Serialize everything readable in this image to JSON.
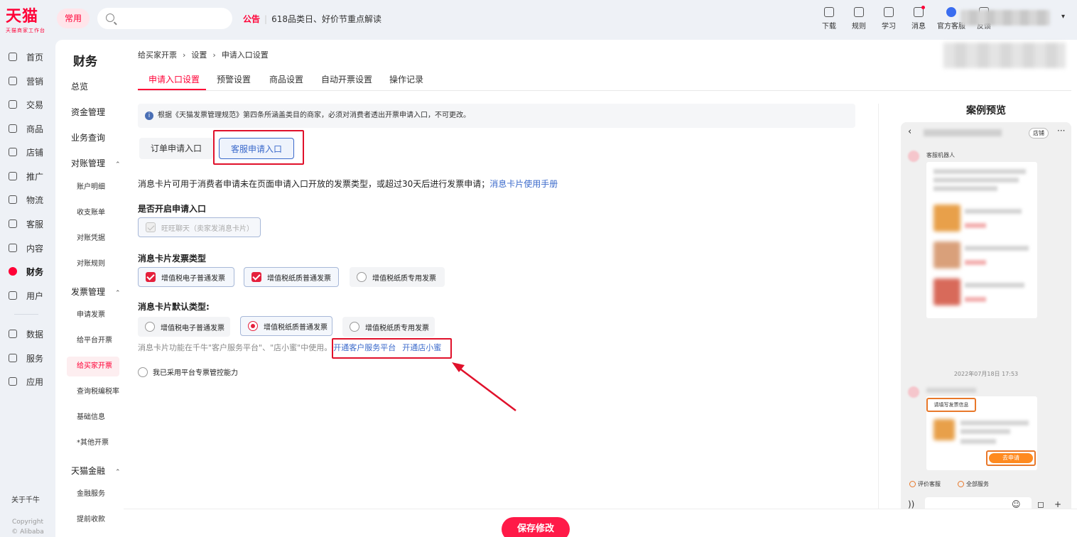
{
  "brand": {
    "name": "天猫",
    "sub": "天猫商家工作台"
  },
  "topbar": {
    "common": "常用",
    "search_placeholder": "",
    "notice_tag": "公告",
    "notice_text": "618品类日、好价节重点解读",
    "tools": [
      {
        "label": "下载",
        "icon": "download-icon"
      },
      {
        "label": "规则",
        "icon": "rules-icon"
      },
      {
        "label": "学习",
        "icon": "learn-icon"
      },
      {
        "label": "消息",
        "icon": "message-icon"
      },
      {
        "label": "官方客服",
        "icon": "support-icon"
      },
      {
        "label": "反馈",
        "icon": "feedback-icon"
      }
    ]
  },
  "leftnav": {
    "items": [
      "首页",
      "营销",
      "交易",
      "商品",
      "店铺",
      "推广",
      "物流",
      "客服",
      "内容",
      "财务",
      "用户",
      "数据",
      "服务",
      "应用"
    ],
    "active": "财务",
    "about": "关于千牛",
    "copyright1": "Copyright",
    "copyright2": "© Alibaba Group"
  },
  "subnav": {
    "title": "财务",
    "items": {
      "overview": "总览",
      "funds": "资金管理",
      "query": "业务查询",
      "recon": "对账管理",
      "recon_children": [
        "账户明细",
        "收支账单",
        "对账凭据",
        "对账规则"
      ],
      "invoice": "发票管理",
      "invoice_children": [
        "申请发票",
        "给平台开票",
        "给买家开票",
        "查询税编税率",
        "基础信息",
        "*其他开票"
      ],
      "finance": "天猫金融",
      "finance_children": [
        "金融服务",
        "提前收款"
      ]
    }
  },
  "breadcrumb": [
    "给买家开票",
    "设置",
    "申请入口设置"
  ],
  "tabs": [
    "申请入口设置",
    "预警设置",
    "商品设置",
    "自动开票设置",
    "操作记录"
  ],
  "info": "根据《天猫发票管理规范》第四条所涵盖类目的商家，必须对消费者透出开票申请入口，不可更改。",
  "entries": {
    "order": "订单申请入口",
    "service": "客服申请入口"
  },
  "desc": {
    "text": "消息卡片可用于消费者申请未在页面申请入口开放的发票类型，或超过30天后进行发票申请；",
    "link": "消息卡片使用手册"
  },
  "section_open": {
    "label": "是否开启申请入口",
    "option": "旺旺聊天（卖家发消息卡片）"
  },
  "section_types": {
    "label": "消息卡片发票类型",
    "options": [
      "增值税电子普通发票",
      "增值税纸质普通发票",
      "增值税纸质专用发票"
    ]
  },
  "section_default": {
    "label": "消息卡片默认类型:",
    "options": [
      "增值税电子普通发票",
      "增值税纸质普通发票",
      "增值税纸质专用发票"
    ]
  },
  "note": {
    "text": "消息卡片功能在千牛\"客户服务平台\"、\"店小蜜\"中使用。",
    "link1": "开通客户服务平台",
    "link2": "开通店小蜜"
  },
  "platform_check": "我已采用平台专票管控能力",
  "preview": {
    "title": "案例预览",
    "shop": "店铺",
    "bot": "客服机器人",
    "date": "2022年07月18日 17:53",
    "invoice_tag": "请填写发票信息",
    "apply": "去申请",
    "chip1": "评价客服",
    "chip2": "全部服务"
  },
  "footer": {
    "save": "保存修改"
  },
  "colors": {
    "accent": "#ff0036",
    "link": "#3b6acb",
    "highlight": "#e0112b"
  }
}
